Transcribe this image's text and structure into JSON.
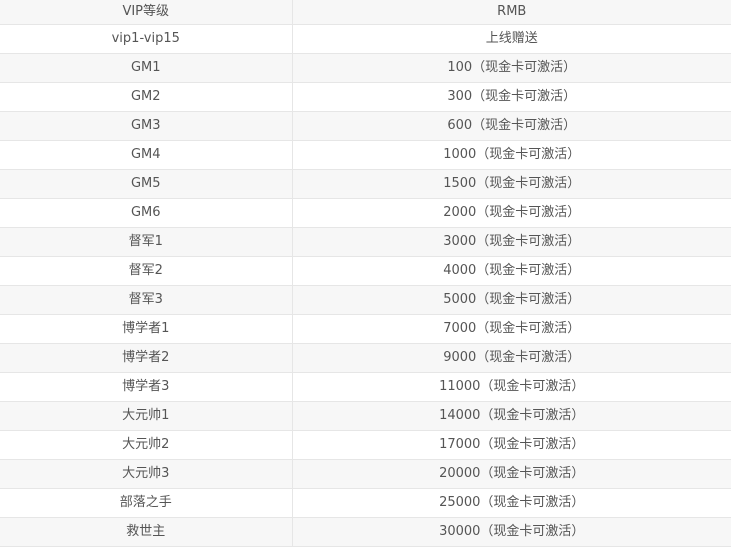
{
  "table": {
    "headers": [
      "VIP等级",
      "RMB"
    ],
    "rows": [
      [
        "vip1-vip15",
        "上线赠送"
      ],
      [
        "GM1",
        "100（现金卡可激活）"
      ],
      [
        "GM2",
        "300（现金卡可激活）"
      ],
      [
        "GM3",
        "600（现金卡可激活）"
      ],
      [
        "GM4",
        "1000（现金卡可激活）"
      ],
      [
        "GM5",
        "1500（现金卡可激活）"
      ],
      [
        "GM6",
        "2000（现金卡可激活）"
      ],
      [
        "督军1",
        "3000（现金卡可激活）"
      ],
      [
        "督军2",
        "4000（现金卡可激活）"
      ],
      [
        "督军3",
        "5000（现金卡可激活）"
      ],
      [
        "博学者1",
        "7000（现金卡可激活）"
      ],
      [
        "博学者2",
        "9000（现金卡可激活）"
      ],
      [
        "博学者3",
        "11000（现金卡可激活）"
      ],
      [
        "大元帅1",
        "14000（现金卡可激活）"
      ],
      [
        "大元帅2",
        "17000（现金卡可激活）"
      ],
      [
        "大元帅3",
        "20000（现金卡可激活）"
      ],
      [
        "部落之手",
        "25000（现金卡可激活）"
      ],
      [
        "救世主",
        "30000（现金卡可激活）"
      ]
    ]
  }
}
